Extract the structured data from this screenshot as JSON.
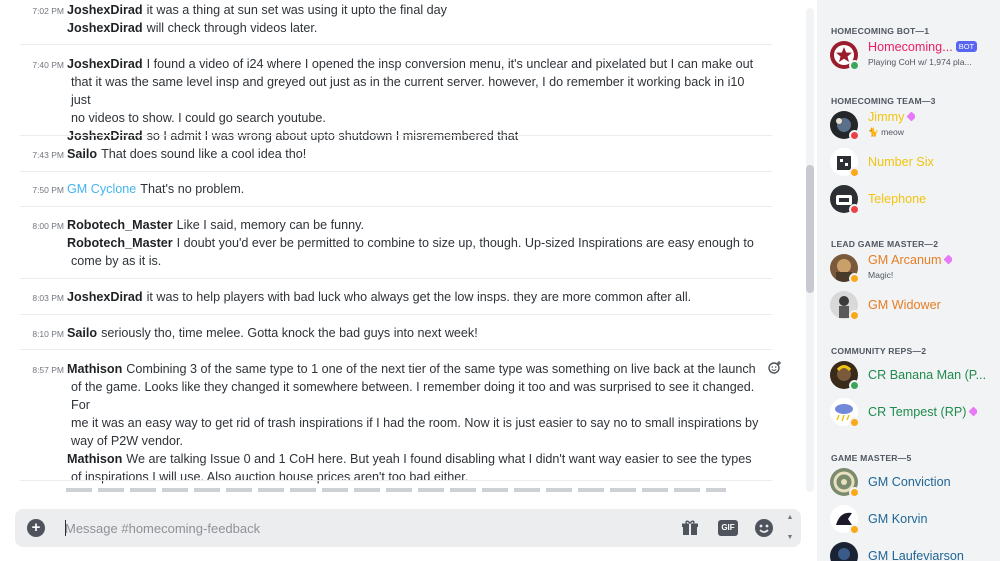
{
  "messages": [
    {
      "time": "7:02 PM",
      "lines": [
        {
          "author": "JoshexDirad",
          "text": "it was a thing at sun set was using it upto the final day"
        },
        {
          "author": "JoshexDirad",
          "text": "will check through videos later."
        }
      ]
    },
    {
      "time": "7:40 PM",
      "lines": [
        {
          "author": "JoshexDirad",
          "text": "I found a video of i24 where I opened the insp conversion menu, it's unclear and pixelated but I can make out"
        },
        {
          "author": "",
          "text": "that it was the same level insp and greyed out just as in the current server. however, I do remember it working back in i10 just"
        },
        {
          "author": "",
          "text": "no videos to show. I could go search youtube."
        },
        {
          "author": "JoshexDirad",
          "text": "so I admit I was wrong about upto shutdown I misremembered that"
        }
      ]
    },
    {
      "time": "7:43 PM",
      "lines": [
        {
          "author": "Sailo",
          "text": "That does sound like a cool idea tho!"
        }
      ]
    },
    {
      "time": "7:50 PM",
      "lines": [
        {
          "author": "GM Cyclone",
          "text": "That's no problem."
        }
      ]
    },
    {
      "time": "8:00 PM",
      "lines": [
        {
          "author": "Robotech_Master",
          "text": "Like I said, memory can be funny."
        },
        {
          "author": "Robotech_Master",
          "text": "I doubt you'd ever be permitted to combine to size up, though. Up-sized Inspirations are easy enough to"
        },
        {
          "author": "",
          "text": "come by as it is."
        }
      ]
    },
    {
      "time": "8:03 PM",
      "lines": [
        {
          "author": "JoshexDirad",
          "text": "it was to help players with bad luck who always get the low insps. they are more common after all."
        }
      ]
    },
    {
      "time": "8:10 PM",
      "lines": [
        {
          "author": "Sailo",
          "text": "seriously tho, time melee. Gotta knock the bad guys into next week!"
        }
      ]
    },
    {
      "time": "8:57 PM",
      "lines": [
        {
          "author": "Mathison",
          "text": "Combining 3 of the same type to 1 one of the next tier of the same type was something on live back at the launch"
        },
        {
          "author": "",
          "text": "of the game. Looks like they changed it somewhere between. I remember doing it too and was surprised to see it changed. For"
        },
        {
          "author": "",
          "text": "me it was an easy way to get rid of trash inspirations if I had the room. Now it is just easier to say no to small inspirations by"
        },
        {
          "author": "",
          "text": "way of P2W vendor."
        },
        {
          "author": "Mathison",
          "text": "We are talking Issue 0 and 1 CoH here. But yeah I found disabling what I didn't want way easier to see the types"
        },
        {
          "author": "",
          "text": "of inspirations I will use. Also auction house prices aren't too bad either."
        }
      ]
    }
  ],
  "composer": {
    "placeholder": "Message #homecoming-feedback",
    "gif_label": "GIF",
    "add_label": "+"
  },
  "members": {
    "categories": [
      {
        "label": "HOMECOMING BOT—1",
        "members": [
          {
            "name": "Homecoming...",
            "sub": "Playing CoH w/ 1,974 pla...",
            "color": "#e91e63",
            "bot": "BOT",
            "status": "online",
            "avatar": "#9b1c2c"
          }
        ]
      },
      {
        "label": "HOMECOMING TEAM—3",
        "members": [
          {
            "name": "Jimmy",
            "sub": "meow",
            "color": "#f1c40f",
            "status": "dnd",
            "avatar": "#23272a",
            "gem": true
          },
          {
            "name": "Number Six",
            "sub": "",
            "color": "#f1c40f",
            "status": "idle",
            "avatar": "#ffffff"
          },
          {
            "name": "Telephone",
            "sub": "",
            "color": "#f1c40f",
            "status": "dnd",
            "avatar": "#2c2f33"
          }
        ]
      },
      {
        "label": "LEAD GAME MASTER—2",
        "members": [
          {
            "name": "GM Arcanum",
            "sub": "Magic!",
            "color": "#e67e22",
            "status": "idle",
            "avatar": "#7a5a3a",
            "gem": true
          },
          {
            "name": "GM Widower",
            "sub": "",
            "color": "#e67e22",
            "status": "idle",
            "avatar": "#d9d9d9"
          }
        ]
      },
      {
        "label": "COMMUNITY REPS—2",
        "members": [
          {
            "name": "CR Banana Man (P...",
            "sub": "",
            "color": "#1f8b4c",
            "status": "online",
            "avatar": "#3a2a1a"
          },
          {
            "name": "CR Tempest (RP)",
            "sub": "",
            "color": "#1f8b4c",
            "status": "idle",
            "avatar": "#7289da",
            "gem": true
          }
        ]
      },
      {
        "label": "GAME MASTER—5",
        "members": [
          {
            "name": "GM Conviction",
            "sub": "",
            "color": "#206694",
            "status": "idle",
            "avatar": "#7b8c6e"
          },
          {
            "name": "GM Korvin",
            "sub": "",
            "color": "#206694",
            "status": "idle",
            "avatar": "#ffffff"
          },
          {
            "name": "GM Laufeviarson",
            "sub": "",
            "color": "#206694",
            "status": "idle",
            "avatar": "#1a2333"
          }
        ]
      }
    ]
  }
}
